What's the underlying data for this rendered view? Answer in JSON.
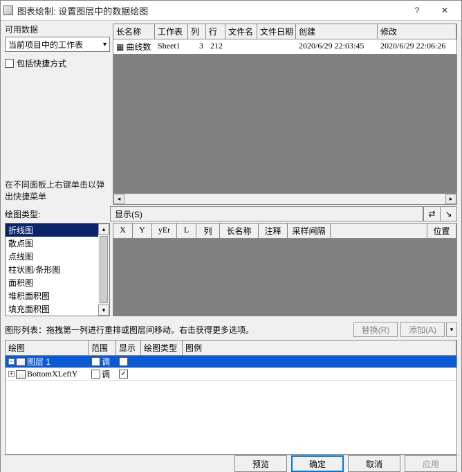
{
  "titlebar": {
    "title": "图表绘制: 设置图层中的数据绘图",
    "help": "?",
    "close": "✕"
  },
  "left": {
    "available_label": "可用数据",
    "worksheet_select": "当前项目中的工作表",
    "include_shortcut": "包括快捷方式",
    "rightclick_tip1": "在不同面板上右键单击以弹",
    "rightclick_tip2": "出快捷菜单"
  },
  "table1": {
    "headers": {
      "longname": "长名称",
      "sheet": "工作表",
      "col": "列",
      "row": "行",
      "filename": "文件名",
      "filedate": "文件日期",
      "created": "创建",
      "modified": "修改"
    },
    "row": {
      "name": "曲线数",
      "sheet": "Sheet1",
      "col": "3",
      "rowv": "212",
      "filename": "",
      "filedate": "",
      "created": "2020/6/29 22:03:45",
      "modified": "2020/6/29 22:06:26"
    }
  },
  "plottype_label": "绘图类型:",
  "show_button": "显示(S)",
  "plottype_items": [
    "折线图",
    "散点图",
    "点线图",
    "柱状图/条形图",
    "面积图",
    "堆积面积图",
    "填充面积图"
  ],
  "grid2_headers": {
    "x": "X",
    "y": "Y",
    "yer": "yEr",
    "l": "L",
    "col": "列",
    "longname": "长名称",
    "note": "注释",
    "sample": "采样间隔",
    "pos": "位置"
  },
  "row4": {
    "label": "图形列表：拖拽第一列进行重排或图层间移动。右击获得更多选项。",
    "replace": "替换(R)",
    "add": "添加(A)"
  },
  "row5": {
    "headers": {
      "plot": "绘图",
      "range": "范围",
      "show": "显示",
      "plottype": "绘图类型",
      "legend": "图例"
    },
    "r1": {
      "name": "图层 1",
      "range": "调"
    },
    "r2": {
      "name": "BottomXLeftY",
      "range": "调"
    }
  },
  "footer": {
    "preview": "预览",
    "ok": "确定",
    "cancel": "取消",
    "apply": "应用"
  }
}
